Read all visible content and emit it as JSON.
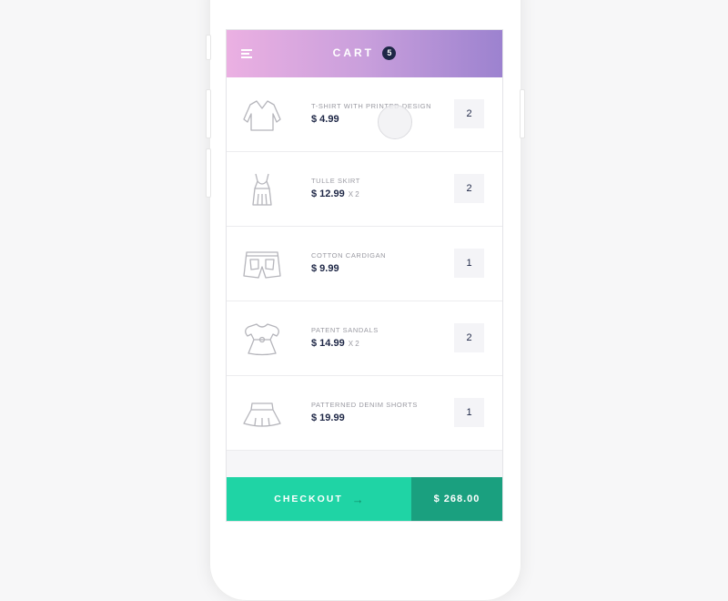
{
  "header": {
    "title": "CART",
    "badge_count": "5",
    "menu_icon": "hamburger-menu-icon"
  },
  "items": [
    {
      "name": "T-SHIRT WITH PRINTED DESIGN",
      "price": "$ 4.99",
      "multiplier": "",
      "quantity": "2",
      "icon": "long-sleeve-shirt-icon"
    },
    {
      "name": "TULLE SKIRT",
      "price": "$ 12.99",
      "multiplier": "X 2",
      "quantity": "2",
      "icon": "tank-dress-icon"
    },
    {
      "name": "COTTON CARDIGAN",
      "price": "$ 9.99",
      "multiplier": "",
      "quantity": "1",
      "icon": "shorts-icon"
    },
    {
      "name": "PATENT SANDALS",
      "price": "$ 14.99",
      "multiplier": "X 2",
      "quantity": "2",
      "icon": "baby-dress-icon"
    },
    {
      "name": "PATTERNED DENIM SHORTS",
      "price": "$ 19.99",
      "multiplier": "",
      "quantity": "1",
      "icon": "skirt-icon"
    }
  ],
  "footer": {
    "checkout_label": "CHECKOUT",
    "arrow_icon": "arrow-right-icon",
    "total": "$ 268.00"
  },
  "colors": {
    "header_gradient_start": "#ebb0e2",
    "header_gradient_end": "#9c82cf",
    "checkout": "#1fd4a5",
    "total": "#1aa07f",
    "dark_text": "#1e2746"
  }
}
